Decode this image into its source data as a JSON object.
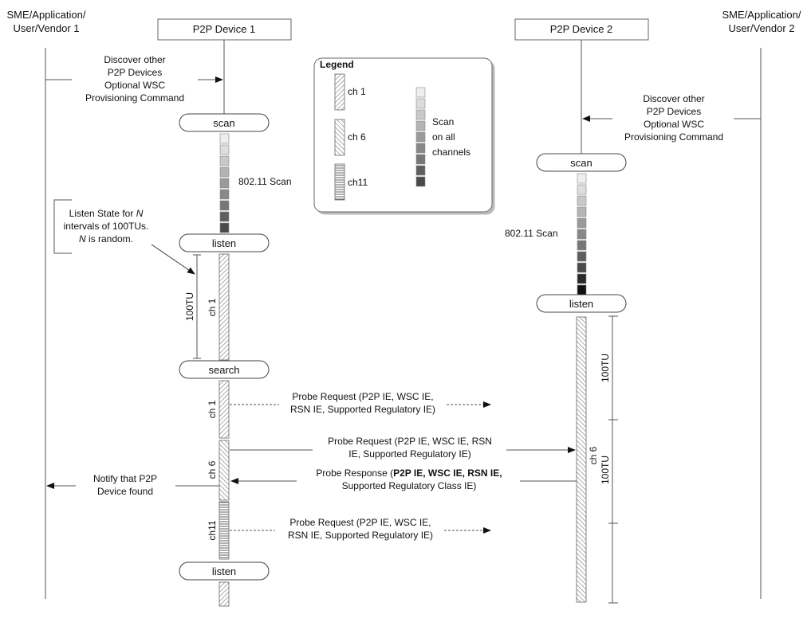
{
  "actors": {
    "left_app": [
      "SME/Application/",
      "User/Vendor 1"
    ],
    "device1": "P2P Device 1",
    "device2": "P2P Device 2",
    "right_app": [
      "SME/Application/",
      "User/Vendor 2"
    ]
  },
  "discover_left": [
    "Discover other",
    "P2P Devices",
    "Optional WSC",
    "Provisioning Command"
  ],
  "discover_right": [
    "Discover other",
    "P2P Devices",
    "Optional WSC",
    "Provisioning Command"
  ],
  "states": {
    "d1_scan": "scan",
    "d1_listen": "listen",
    "d1_search": "search",
    "d1_listen2": "listen",
    "d2_scan": "scan",
    "d2_listen": "listen"
  },
  "scan_label_d1": "802.11 Scan",
  "scan_label_d2": "802.11 Scan",
  "listen_note": [
    "Listen State for N",
    "intervals of 100TUs.",
    "N is random."
  ],
  "channel_labels": {
    "d1_listen_ch": "ch 1",
    "d1_search_ch1": "ch 1",
    "d1_search_ch6": "ch 6",
    "d1_search_ch11": "ch11",
    "d2_listen_ch": "ch 6"
  },
  "interval_labels": {
    "d1": "100TU",
    "d2_a": "100TU",
    "d2_b": "100TU"
  },
  "messages": {
    "probe_req_1": [
      "Probe Request (P2P IE, WSC IE,",
      "RSN IE, Supported Regulatory IE)"
    ],
    "probe_req_2": [
      "Probe Request (P2P IE, WSC IE, RSN",
      "IE, Supported Regulatory IE)"
    ],
    "probe_resp": [
      "Probe Response (",
      "P2P IE, WSC IE, RSN IE,",
      "Supported Regulatory Class IE)"
    ],
    "probe_req_3": [
      "Probe Request (P2P IE, WSC IE,",
      "RSN IE, Supported Regulatory IE)"
    ],
    "notify": [
      "Notify that P2P",
      "Device found"
    ]
  },
  "legend": {
    "title": "Legend",
    "ch1": "ch 1",
    "ch6": "ch 6",
    "ch11": "ch11",
    "scan": [
      "Scan",
      "on all",
      "channels"
    ]
  },
  "scan_shades_d1": [
    "#eeeeee",
    "#dddddd",
    "#c8c8c8",
    "#b4b4b4",
    "#9a9a9a",
    "#888888",
    "#777777",
    "#5e5e5e",
    "#4a4a4a"
  ],
  "scan_shades_d2": [
    "#eeeeee",
    "#dddddd",
    "#c8c8c8",
    "#b4b4b4",
    "#9a9a9a",
    "#888888",
    "#777777",
    "#5e5e5e",
    "#4a4a4a",
    "#2a2a2a",
    "#111111"
  ],
  "scan_shades_legend": [
    "#eeeeee",
    "#dddddd",
    "#c8c8c8",
    "#b4b4b4",
    "#9a9a9a",
    "#888888",
    "#777777",
    "#5e5e5e",
    "#4a4a4a"
  ]
}
